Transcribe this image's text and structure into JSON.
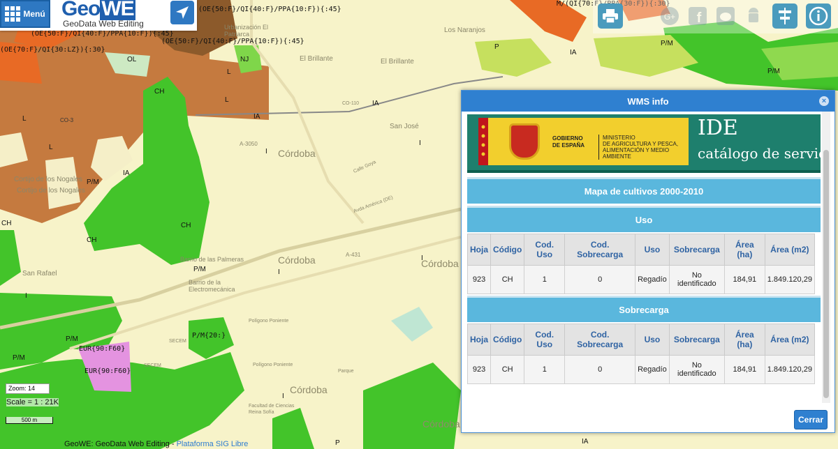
{
  "header": {
    "menu_label": "Menú",
    "logo_geo": "Geo",
    "logo_we": "WE",
    "logo_sub": "GeoData Web Editing"
  },
  "toolbar": {
    "icons": [
      "printer-icon",
      "google-plus-icon",
      "facebook-icon",
      "twitter-icon",
      "android-icon",
      "layers-filter-icon",
      "info-icon"
    ]
  },
  "map": {
    "places": [
      "Córdoba",
      "Córdoba",
      "Córdoba",
      "Córdoba",
      "Córdoba",
      "San José",
      "El Brillante",
      "El Brillante",
      "Los Naranjos",
      "Urbanización El Patriarca",
      "Cortijo de los Nogales",
      "Cortijo de los Nogales",
      "San Rafael",
      "Barrio de las Palmeras",
      "Barrio de la Electromecánica",
      "Polígono Poniente",
      "Polígono Poniente",
      "SECEM",
      "SECEM",
      "Parque",
      "Facultad de Ciencias Reina Sofía",
      "Calle Goya",
      "Avda América (DE)",
      "A-431",
      "A-3050",
      "CO-110",
      "CO-3"
    ],
    "codes": [
      "(OE{50:F}/QI{40:F}/PPA{10:F}){:45}",
      "(OE{50:F}/QI{40:F}/PPA{10:F}){:45}",
      "(OE{50:F}/QI{40:F}/PPA{10:F}){:45}",
      "(OE{70:F}/QI{30:LZ}){:30}",
      "M/(QI{70:F}/PPA{30:F}){:30}",
      "EUR{90:F60}",
      "EUR{90:F60}",
      "P/M{20:}"
    ],
    "symbols": [
      "L",
      "L",
      "L",
      "L",
      "OL",
      "CH",
      "CH",
      "CH",
      "CH",
      "P/M",
      "P/M",
      "P/M",
      "P/M",
      "P/M",
      "P/M",
      "IA",
      "IA",
      "IA",
      "IA",
      "IA",
      "I",
      "I",
      "I",
      "I",
      "I",
      "I",
      "P",
      "P",
      "NJ"
    ]
  },
  "dialog": {
    "title": "WMS info",
    "banner": {
      "gobierno": "GOBIERNO\nDE ESPAÑA",
      "ministerio": "MINISTERIO\nDE AGRICULTURA Y PESCA,\nALIMENTACIÓN Y MEDIO AMBIENTE",
      "ide": "IDE",
      "catalogo": "catálogo de servicios"
    },
    "map_title": "Mapa de cultivos 2000-2010",
    "sections": [
      {
        "title": "Uso",
        "headers": [
          "Hoja",
          "Código",
          "Cod. Uso",
          "Cod. Sobrecarga",
          "Uso",
          "Sobrecarga",
          "Área (ha)",
          "Área (m2)"
        ],
        "row": [
          "923",
          "CH",
          "1",
          "0",
          "Regadío",
          "No identificado",
          "184,91",
          "1.849.120,29"
        ]
      },
      {
        "title": "Sobrecarga",
        "headers": [
          "Hoja",
          "Código",
          "Cod. Uso",
          "Cod. Sobrecarga",
          "Uso",
          "Sobrecarga",
          "Área (ha)",
          "Área (m2)"
        ],
        "row": [
          "923",
          "CH",
          "1",
          "0",
          "Regadío",
          "No identificado",
          "184,91",
          "1.849.120,29"
        ]
      }
    ],
    "close_label": "Cerrar"
  },
  "overlay": {
    "zoom": "Zoom: 14",
    "scale": "Scale = 1 : 21K",
    "scale_bar": "500 m",
    "footer_text": "GeoWE: GeoData Web Editing - ",
    "footer_link": "Plataforma SIG Libre"
  }
}
